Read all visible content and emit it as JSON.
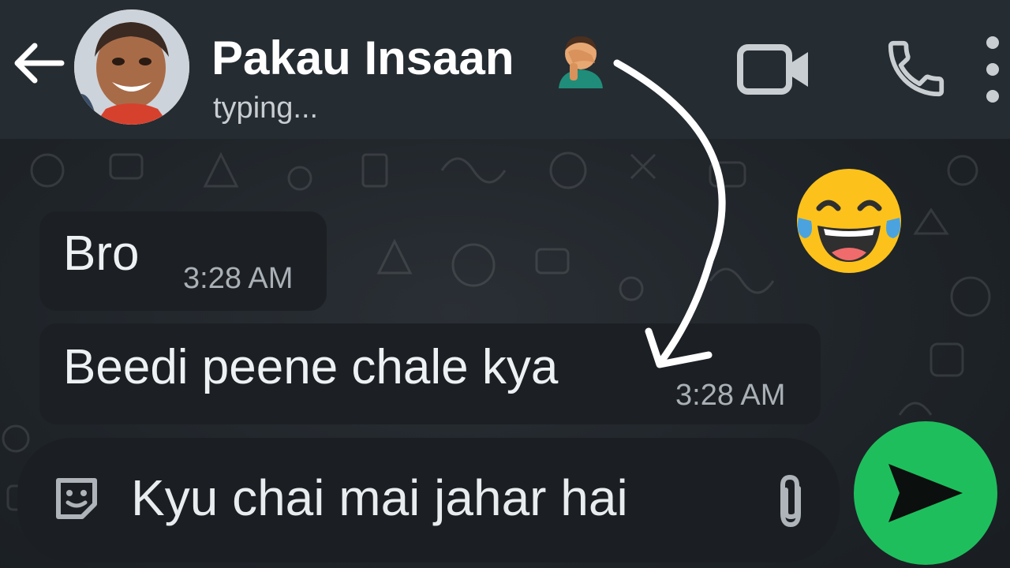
{
  "header": {
    "contact_name": "Pakau Insaan",
    "status": "typing...",
    "avatar_icon": "contact-avatar",
    "name_emoji_icon": "facepalm-icon",
    "back_icon": "back-arrow-icon",
    "video_icon": "video-call-icon",
    "call_icon": "phone-icon",
    "menu_icon": "more-vertical-icon"
  },
  "messages": [
    {
      "text": "Bro",
      "time": "3:28 AM"
    },
    {
      "text": "Beedi peene chale kya",
      "time": "3:28 AM"
    }
  ],
  "overlay": {
    "emoji_icon": "tears-of-joy-icon",
    "arrow_icon": "curved-arrow-icon"
  },
  "composer": {
    "value": "Kyu chai mai jahar hai",
    "sticker_icon": "sticker-icon",
    "attach_icon": "paperclip-icon"
  },
  "send": {
    "icon": "send-icon"
  },
  "colors": {
    "header_bg": "#252c32",
    "bubble_bg": "#1c2024",
    "send_green": "#1fbe5d",
    "text_white": "#ffffff",
    "time_gray": "#a9b0b6"
  }
}
